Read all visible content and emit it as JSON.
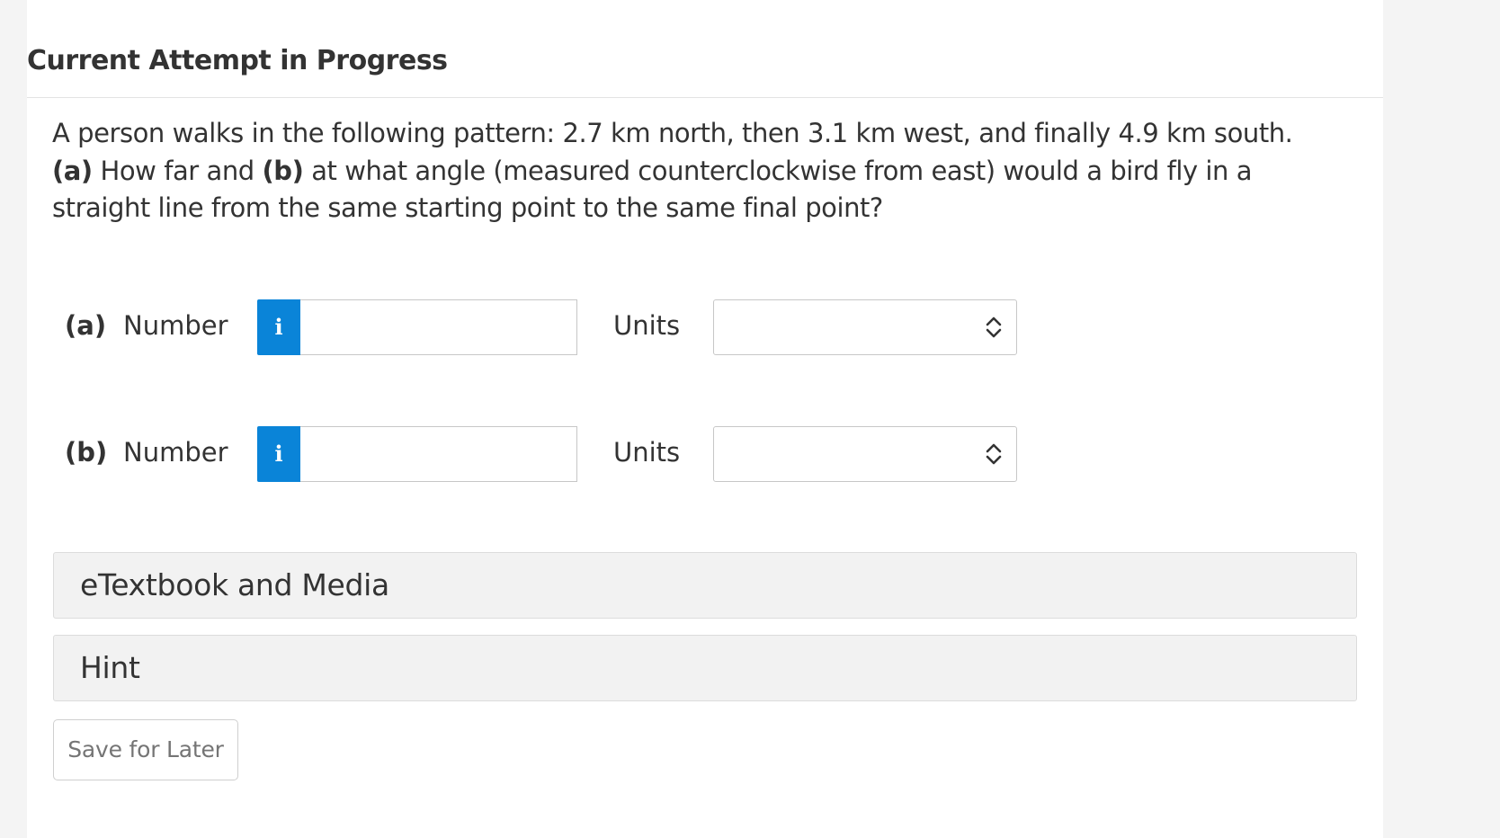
{
  "header": {
    "title": "Current Attempt in Progress"
  },
  "question": {
    "text_1": "A person walks in the following pattern: 2.7 km north, then 3.1 km west, and finally 4.9 km south. ",
    "part_a_tag": "(a)",
    "text_2": " How far and ",
    "part_b_tag": "(b)",
    "text_3": " at what angle (measured counterclockwise from east) would a bird fly in a straight line from the same starting point to the same final point?"
  },
  "answers": [
    {
      "part_label": "(a)",
      "number_label": "Number",
      "info_icon": "i",
      "number_value": "",
      "units_label": "Units",
      "units_value": ""
    },
    {
      "part_label": "(b)",
      "number_label": "Number",
      "info_icon": "i",
      "number_value": "",
      "units_label": "Units",
      "units_value": ""
    }
  ],
  "sections": {
    "etextbook_label": "eTextbook and Media",
    "hint_label": "Hint"
  },
  "actions": {
    "save_label": "Save for Later"
  },
  "colors": {
    "info_button": "#0a84d8",
    "text": "#333333",
    "accordion_bg": "#f2f2f2"
  },
  "icons": {
    "info": "info-icon",
    "select": "chevron-up-down-icon"
  }
}
